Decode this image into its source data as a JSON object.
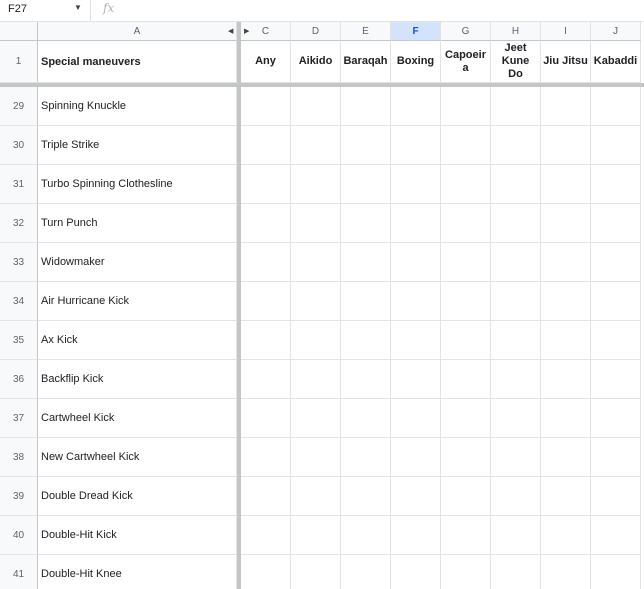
{
  "formula_bar": {
    "name_box": "F27",
    "fx_label": "fx",
    "content": ""
  },
  "columns": [
    {
      "id": "C",
      "active": false
    },
    {
      "id": "D",
      "active": false
    },
    {
      "id": "E",
      "active": false
    },
    {
      "id": "F",
      "active": true
    },
    {
      "id": "G",
      "active": false
    },
    {
      "id": "H",
      "active": false
    },
    {
      "id": "I",
      "active": false
    },
    {
      "id": "J",
      "active": false
    }
  ],
  "column_a": {
    "id": "A"
  },
  "header_row": {
    "number": "1",
    "a_label": "Special maneuvers",
    "labels": [
      "Any",
      "Aikido",
      "Baraqah",
      "Boxing",
      "Capoeir\na",
      "Jeet\nKune\nDo",
      "Jiu Jitsu",
      "Kabaddi"
    ]
  },
  "rows": [
    {
      "number": "29",
      "a": "Spinning Knuckle"
    },
    {
      "number": "30",
      "a": "Triple Strike"
    },
    {
      "number": "31",
      "a": "Turbo Spinning Clothesline"
    },
    {
      "number": "32",
      "a": "Turn Punch"
    },
    {
      "number": "33",
      "a": "Widowmaker"
    },
    {
      "number": "34",
      "a": "Air Hurricane Kick"
    },
    {
      "number": "35",
      "a": "Ax Kick"
    },
    {
      "number": "36",
      "a": "Backflip Kick"
    },
    {
      "number": "37",
      "a": "Cartwheel Kick"
    },
    {
      "number": "38",
      "a": "New Cartwheel Kick"
    },
    {
      "number": "39",
      "a": "Double Dread Kick"
    },
    {
      "number": "40",
      "a": "Double-Hit Kick"
    },
    {
      "number": "41",
      "a": "Double-Hit Knee"
    }
  ]
}
